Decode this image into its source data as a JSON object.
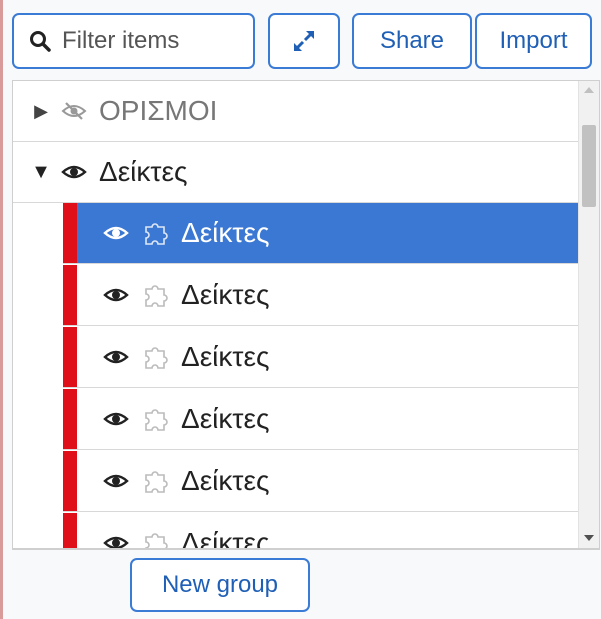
{
  "toolbar": {
    "filter_placeholder": "Filter items",
    "expand_icon": "expand-arrows-icon",
    "share_label": "Share",
    "import_label": "Import"
  },
  "tree": {
    "rows": [
      {
        "label": "ΟΡΙΣΜΟΙ",
        "expanded": false,
        "visible": false
      },
      {
        "label": "Δείκτες",
        "expanded": true,
        "visible": true
      }
    ],
    "children": [
      {
        "label": "Δείκτες",
        "selected": true
      },
      {
        "label": "Δείκτες",
        "selected": false
      },
      {
        "label": "Δείκτες",
        "selected": false
      },
      {
        "label": "Δείκτες",
        "selected": false
      },
      {
        "label": "Δείκτες",
        "selected": false
      },
      {
        "label": "Δείκτες",
        "selected": false
      }
    ]
  },
  "footer": {
    "new_group_label": "New group"
  },
  "colors": {
    "accent": "#3b78d3",
    "stripe": "#e0101a",
    "border": "#3a7bd5"
  }
}
